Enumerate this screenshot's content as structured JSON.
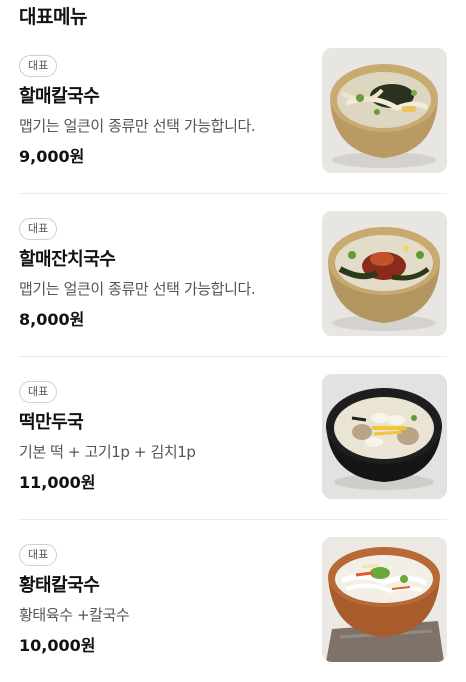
{
  "section": {
    "title": "대표메뉴"
  },
  "menu": [
    {
      "badge": "대표",
      "name": "할매칼국수",
      "description": "맵기는 얼큰이 종류만 선택 가능합니다.",
      "price": "9,000원",
      "photo_icon": "kalguksu-bowl-photo"
    },
    {
      "badge": "대표",
      "name": "할매잔치국수",
      "description": "맵기는 얼큰이 종류만 선택 가능합니다.",
      "price": "8,000원",
      "photo_icon": "janchi-guksu-bowl-photo"
    },
    {
      "badge": "대표",
      "name": "떡만두국",
      "description": "기본 떡 + 고기1p + 김치1p",
      "price": "11,000원",
      "photo_icon": "tteok-mandu-guk-bowl-photo"
    },
    {
      "badge": "대표",
      "name": "황태칼국수",
      "description": "황태육수 +칼국수",
      "price": "10,000원",
      "photo_icon": "hwangtae-kalguksu-bowl-photo"
    }
  ]
}
